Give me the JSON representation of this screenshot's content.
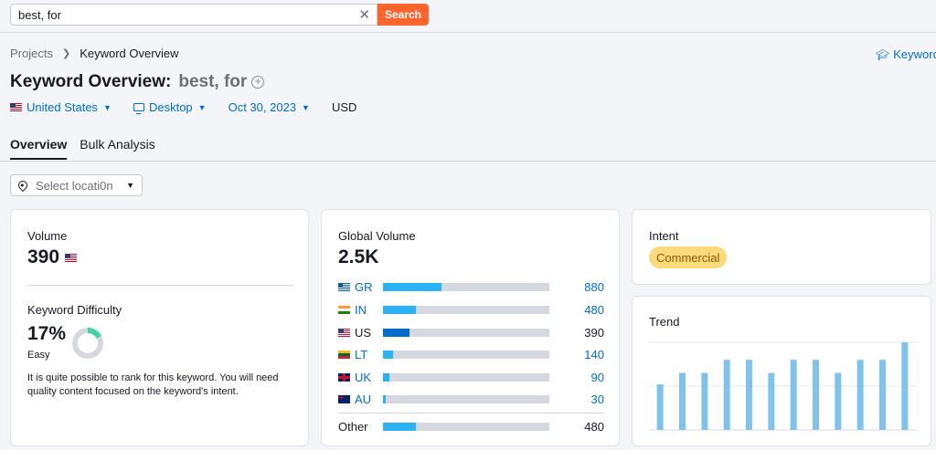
{
  "search": {
    "value": "best, for",
    "button": "Search"
  },
  "breadcrumb": {
    "root": "Projects",
    "current": "Keyword Overview"
  },
  "academy_link": "Keyword",
  "title": {
    "label": "Keyword Overview:",
    "keyword": "best, for"
  },
  "filters": {
    "country": "United States",
    "device": "Desktop",
    "date": "Oct 30, 2023",
    "currency": "USD"
  },
  "tabs": [
    {
      "label": "Overview",
      "active": true
    },
    {
      "label": "Bulk Analysis",
      "active": false
    }
  ],
  "location_select": {
    "placeholder": "Select locati0n"
  },
  "volume_card": {
    "volume_label": "Volume",
    "volume_value": "390",
    "kd_label": "Keyword Difficulty",
    "kd_value": "17%",
    "kd_percent": 17,
    "kd_level": "Easy",
    "kd_description": "It is quite possible to rank for this keyword. You will need quality content focused on the keyword's intent."
  },
  "global_card": {
    "label": "Global Volume",
    "value": "2.5K",
    "countries": [
      {
        "code": "GR",
        "value": "880",
        "share": 0.35,
        "link": true
      },
      {
        "code": "IN",
        "value": "480",
        "share": 0.2,
        "link": true
      },
      {
        "code": "US",
        "value": "390",
        "share": 0.16,
        "link": false,
        "dark": true
      },
      {
        "code": "LT",
        "value": "140",
        "share": 0.06,
        "link": true
      },
      {
        "code": "UK",
        "value": "90",
        "share": 0.04,
        "link": true
      },
      {
        "code": "AU",
        "value": "30",
        "share": 0.015,
        "link": true
      }
    ],
    "other": {
      "label": "Other",
      "value": "480",
      "share": 0.2
    }
  },
  "intent_card": {
    "label": "Intent",
    "badge": "Commercial"
  },
  "trend_card": {
    "label": "Trend",
    "values": [
      0.52,
      0.65,
      0.65,
      0.8,
      0.8,
      0.65,
      0.8,
      0.8,
      0.65,
      0.8,
      0.8,
      1.0
    ]
  },
  "colors": {
    "accent": "#ff642d",
    "link": "#006dca",
    "bar": "#2bb2f5",
    "bar_dark": "#006dca",
    "trend": "#7fc3ec",
    "donut_fill": "#3fd3a4",
    "donut_track": "#d6d8e0"
  }
}
